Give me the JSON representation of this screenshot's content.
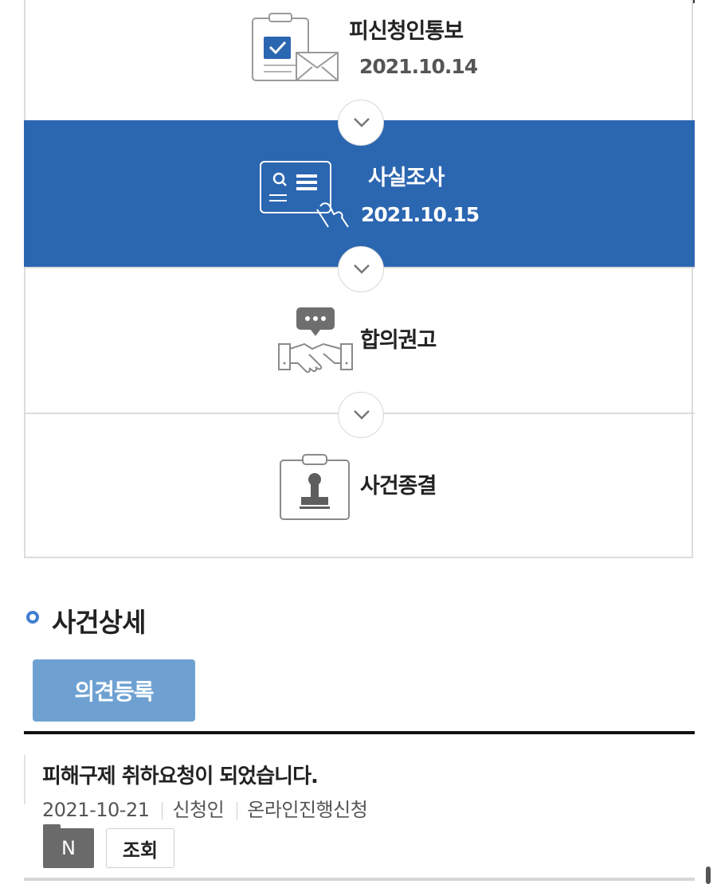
{
  "timeline": {
    "steps": [
      {
        "title": "피신청인통보",
        "date": "2021.10.14",
        "icon": "clipboard-envelope-icon",
        "active": false
      },
      {
        "title": "사실조사",
        "date": "2021.10.15",
        "icon": "document-search-hand-icon",
        "active": true
      },
      {
        "title": "합의권고",
        "date": "",
        "icon": "handshake-chat-icon",
        "active": false
      },
      {
        "title": "사건종결",
        "date": "",
        "icon": "stamp-clipboard-icon",
        "active": false
      }
    ],
    "active_color": "#2b66b1"
  },
  "section": {
    "title": "사건상세"
  },
  "opinion_button": {
    "label": "의견등록",
    "color": "#6ea1d2"
  },
  "post": {
    "title": "피해구제 취하요청이 되었습니다.",
    "date": "2021-10-21",
    "author": "신청인",
    "category": "온라인진행신청",
    "badge": "N",
    "view_label": "조회"
  }
}
